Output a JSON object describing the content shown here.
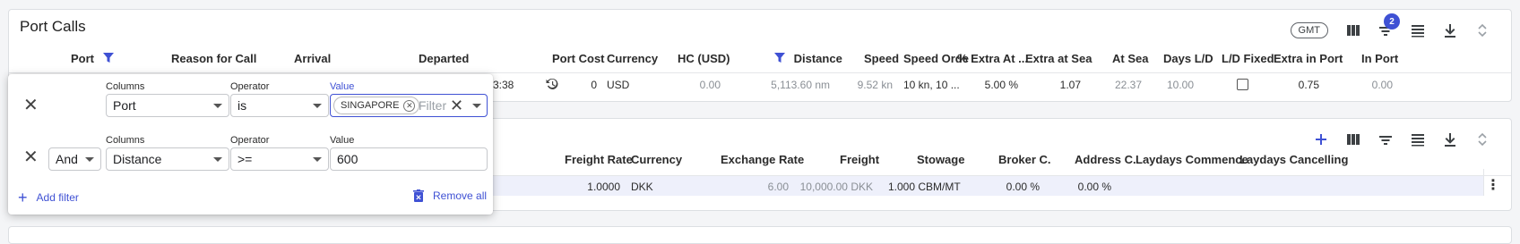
{
  "port_calls": {
    "title": "Port Calls",
    "gmt_label": "GMT",
    "filter_badge": "2",
    "columns": [
      {
        "key": "port",
        "label": "Port"
      },
      {
        "key": "reason",
        "label": "Reason for Call"
      },
      {
        "key": "arrival",
        "label": "Arrival"
      },
      {
        "key": "departed",
        "label": "Departed"
      },
      {
        "key": "port_cost",
        "label": "Port Cost"
      },
      {
        "key": "currency",
        "label": "Currency"
      },
      {
        "key": "hc_usd",
        "label": "HC (USD)"
      },
      {
        "key": "distance",
        "label": "Distance"
      },
      {
        "key": "speed",
        "label": "Speed"
      },
      {
        "key": "speed_order",
        "label": "Speed Orde"
      },
      {
        "key": "extra_at",
        "label": "% Extra At ..."
      },
      {
        "key": "extra_at_sea",
        "label": "Extra at Sea"
      },
      {
        "key": "at_sea",
        "label": "At Sea"
      },
      {
        "key": "days_ld",
        "label": "Days L/D"
      },
      {
        "key": "ld_fixed",
        "label": "L/D Fixed"
      },
      {
        "key": "extra_in_port",
        "label": "Extra in Port"
      },
      {
        "key": "in_port",
        "label": "In Port"
      }
    ],
    "row": {
      "departed_partial": "3:38",
      "port_cost": "0",
      "currency": "USD",
      "hc_usd": "0.00",
      "distance": "5,113.60 nm",
      "speed": "9.52 kn",
      "speed_order": "10 kn, 10 ...",
      "extra_at": "5.00 %",
      "extra_at_sea": "1.07",
      "at_sea": "22.37",
      "days_ld": "10.00",
      "extra_in_port": "0.75",
      "in_port": "0.00"
    }
  },
  "cargo": {
    "columns": [
      {
        "key": "freight_rate",
        "label": "Freight Rate"
      },
      {
        "key": "currency",
        "label": "Currency"
      },
      {
        "key": "exchange_rate",
        "label": "Exchange Rate"
      },
      {
        "key": "freight",
        "label": "Freight"
      },
      {
        "key": "stowage",
        "label": "Stowage"
      },
      {
        "key": "broker_c",
        "label": "Broker C."
      },
      {
        "key": "address_c",
        "label": "Address C."
      },
      {
        "key": "laydays_commence",
        "label": "Laydays Commence"
      },
      {
        "key": "laydays_cancelling",
        "label": "Laydays Cancelling"
      }
    ],
    "row": {
      "freight_rate": "1.0000",
      "currency": "DKK",
      "exchange_rate": "6.00",
      "freight": "10,000.00 DKK",
      "stowage": "1.000 CBM/MT",
      "broker_c": "0.00 %",
      "address_c": "0.00 %"
    }
  },
  "filter_popup": {
    "columns_label": "Columns",
    "operator_label": "Operator",
    "value_label": "Value",
    "filters": [
      {
        "column": "Port",
        "operator": "is",
        "chip": "SINGAPORE",
        "placeholder": "Filter"
      },
      {
        "logic": "And",
        "column": "Distance",
        "operator": ">=",
        "value": "600"
      }
    ],
    "add_filter": "Add filter",
    "remove_all": "Remove all"
  },
  "colors": {
    "accent": "#3f51d4",
    "row_highlight": "#eef0fb"
  }
}
